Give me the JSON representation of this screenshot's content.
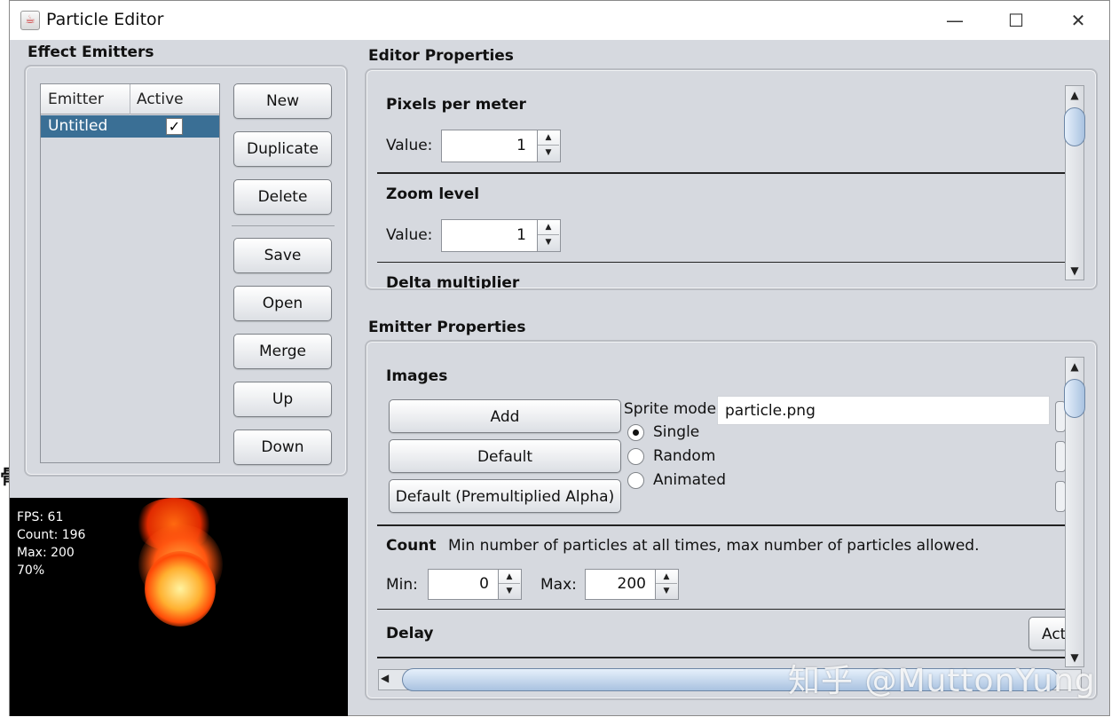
{
  "window": {
    "title": "Particle Editor",
    "controls": {
      "minimize": "—",
      "maximize": "☐",
      "close": "✕"
    }
  },
  "effect_emitters": {
    "title": "Effect Emitters",
    "table": {
      "headers": [
        "Emitter",
        "Active"
      ],
      "rows": [
        {
          "name": "Untitled",
          "active": true
        }
      ]
    },
    "buttons": {
      "new": "New",
      "duplicate": "Duplicate",
      "delete": "Delete",
      "save": "Save",
      "open": "Open",
      "merge": "Merge",
      "up": "Up",
      "down": "Down"
    }
  },
  "preview": {
    "fps": "FPS: 61",
    "count": "Count: 196",
    "max": "Max: 200",
    "percent": "70%"
  },
  "editor_properties": {
    "title": "Editor Properties",
    "pixels_per_meter": {
      "label": "Pixels per meter",
      "value_label": "Value:",
      "value": "1"
    },
    "zoom_level": {
      "label": "Zoom level",
      "value_label": "Value:",
      "value": "1"
    },
    "cut_off": "Delta multiplier"
  },
  "emitter_properties": {
    "title": "Emitter Properties",
    "images": {
      "label": "Images",
      "add": "Add",
      "default": "Default",
      "default_premult": "Default (Premultiplied Alpha)",
      "sprite_mode_label": "Sprite mode:",
      "file": "particle.png",
      "modes": [
        "Single",
        "Random",
        "Animated"
      ],
      "selected_mode": "Single"
    },
    "count": {
      "label": "Count",
      "description": "Min number of particles at all times, max number of particles allowed.",
      "min_label": "Min:",
      "min": "0",
      "max_label": "Max:",
      "max": "200"
    },
    "delay": {
      "label": "Delay",
      "active_button": "Act"
    }
  },
  "watermark": "知乎 @MuttonYung",
  "colors": {
    "selection": "#3a6f95",
    "panel_bg": "#d6d9df",
    "preview_bg": "#000000"
  }
}
